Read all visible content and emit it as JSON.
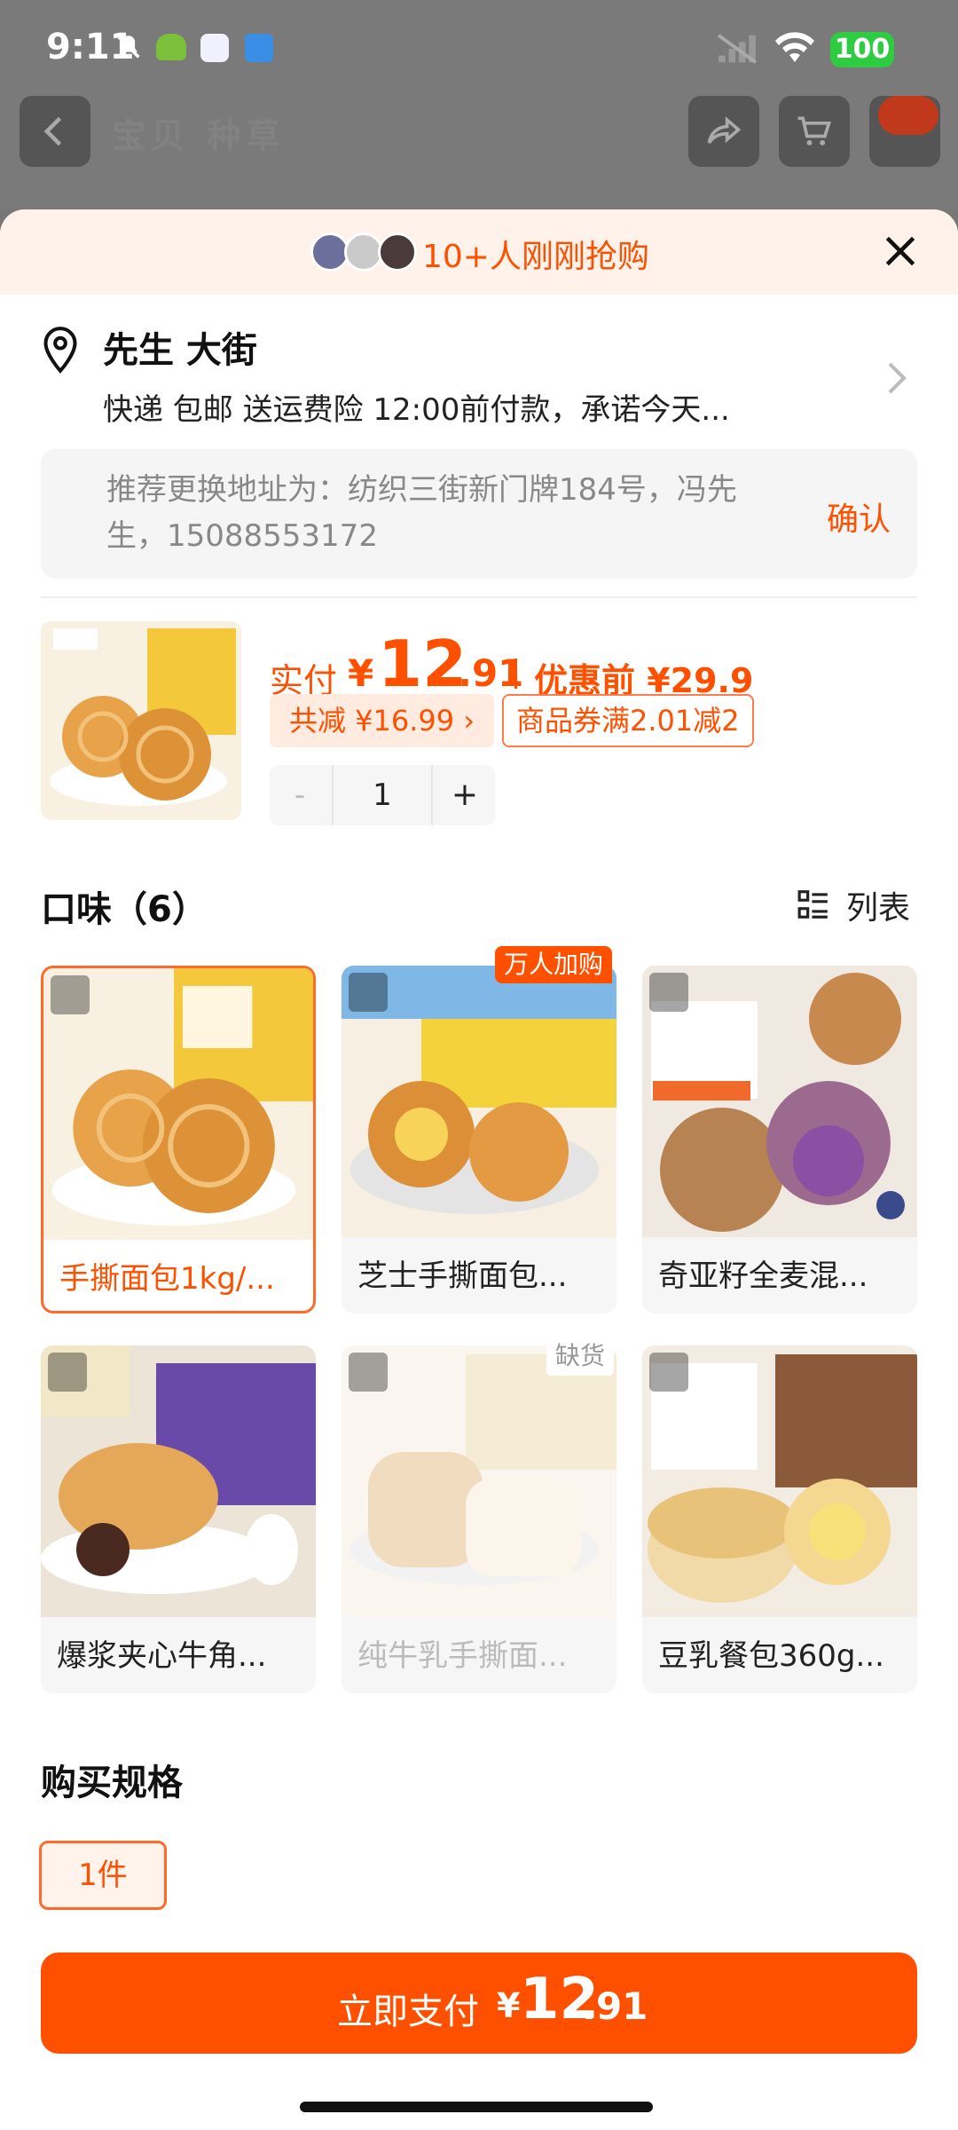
{
  "status": {
    "time": "9:11",
    "battery": "100"
  },
  "nav": {
    "title": "宝贝 种草"
  },
  "banner": {
    "text": "10+人刚刚抢购"
  },
  "address": {
    "name": "先生 大街",
    "shipping": "快递 包邮 送运费险 12:00前付款，承诺今天...",
    "suggestion": "推荐更换地址为：纺织三街新门牌184号，冯先生，15088553172",
    "confirm_label": "确认"
  },
  "price": {
    "label": "实付",
    "yen": "¥",
    "integer": "12",
    "decimal": ".91",
    "original": "优惠前 ¥29.9",
    "saving": "共减 ¥16.99 ›",
    "coupon": "商品券满2.01减2"
  },
  "quantity": {
    "minus": "-",
    "value": "1",
    "plus": "+"
  },
  "flavor": {
    "title": "口味（6）",
    "list_label": "列表",
    "items": [
      {
        "label": "手撕面包1kg/...",
        "selected": true
      },
      {
        "label": "芝士手撕面包...",
        "tag": "万人加购"
      },
      {
        "label": "奇亚籽全麦混..."
      },
      {
        "label": "爆浆夹心牛角..."
      },
      {
        "label": "纯牛乳手撕面...",
        "tag": "缺货"
      },
      {
        "label": "豆乳餐包360g..."
      }
    ]
  },
  "spec": {
    "title": "购买规格",
    "option": "1件"
  },
  "pay": {
    "label": "立即支付",
    "yen": "¥",
    "integer": "12",
    "decimal": ".91"
  },
  "colors": {
    "accent": "#ff5000",
    "banner_bg": "#fff2ea"
  }
}
